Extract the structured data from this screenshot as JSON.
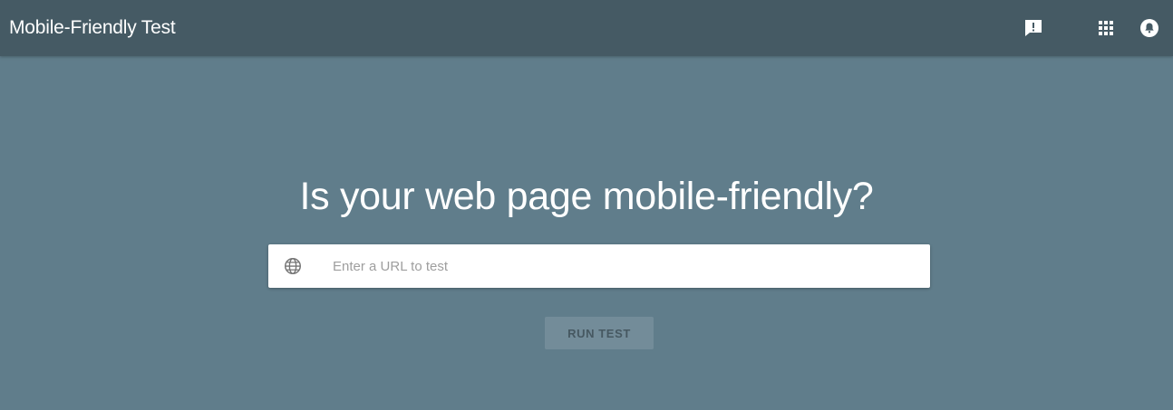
{
  "header": {
    "title": "Mobile-Friendly Test",
    "icons": [
      "feedback-icon",
      "apps-grid-icon",
      "notifications-icon"
    ]
  },
  "main": {
    "heading": "Is your web page mobile-friendly?",
    "url_input": {
      "placeholder": "Enter a URL to test",
      "value": ""
    },
    "run_button_label": "RUN TEST"
  },
  "colors": {
    "background": "#607d8b",
    "header": "#455a64",
    "text": "#ffffff"
  }
}
